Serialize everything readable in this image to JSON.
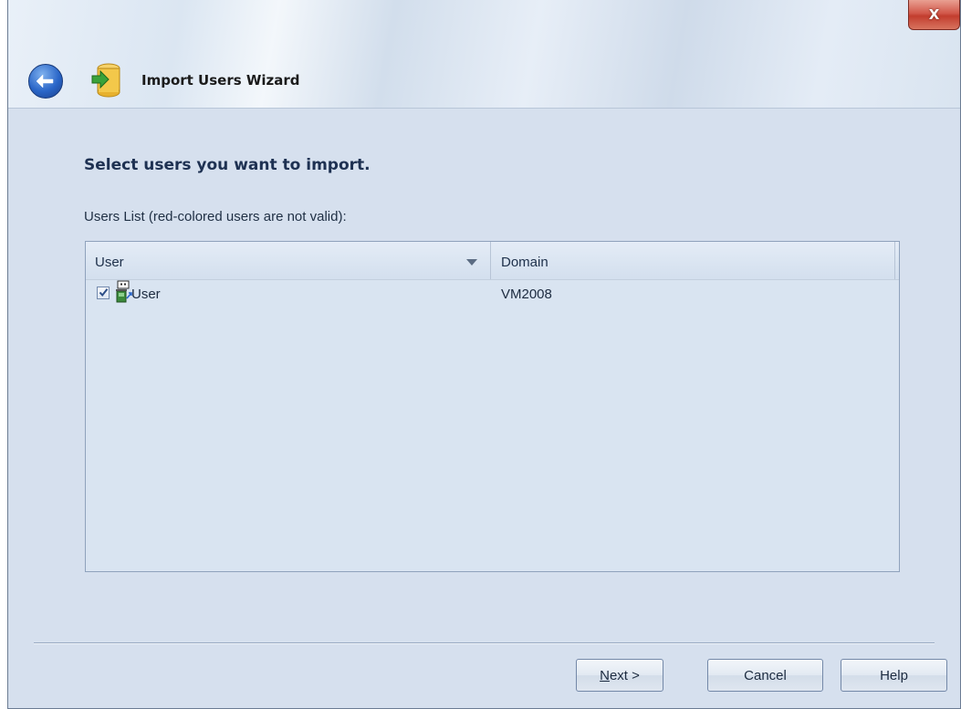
{
  "window": {
    "title": "Import Users Wizard",
    "close_label": "X"
  },
  "page": {
    "heading": "Select users you want to import.",
    "list_caption": "Users List (red-colored users are not valid):"
  },
  "list": {
    "columns": {
      "user": "User",
      "domain": "Domain"
    },
    "rows": [
      {
        "checked": true,
        "user": "User",
        "domain": "VM2008"
      }
    ]
  },
  "buttons": {
    "next_mnemonic": "N",
    "next_rest": "ext >",
    "cancel": "Cancel",
    "help": "Help"
  },
  "colors": {
    "window_bg": "#d6e0ee",
    "heading": "#1e3152",
    "close": "#c23d2e"
  }
}
